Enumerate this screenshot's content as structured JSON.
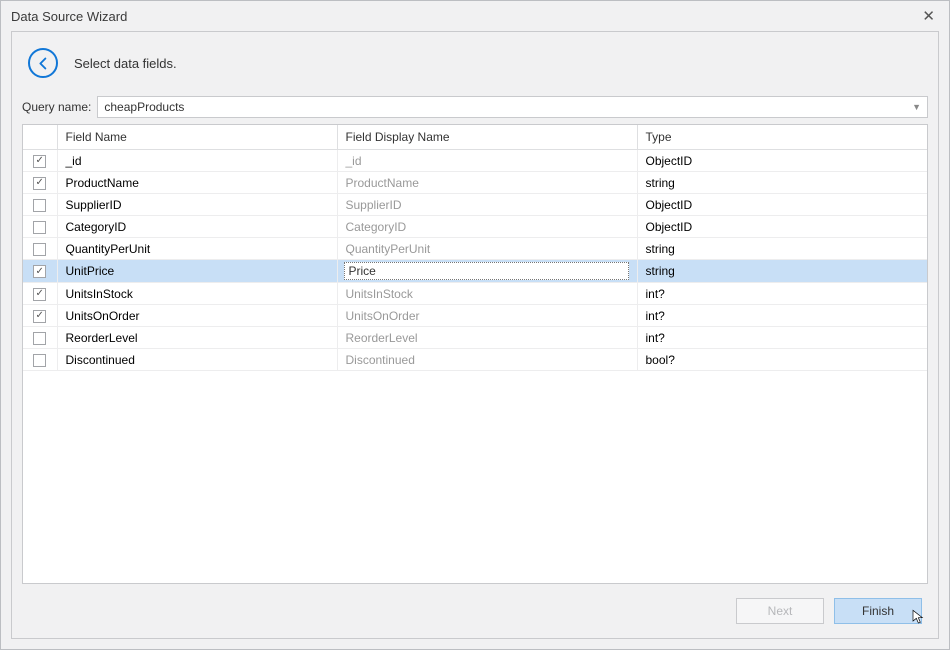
{
  "dialog": {
    "title": "Data Source Wizard",
    "close_glyph": "✕"
  },
  "header": {
    "instruction": "Select data fields."
  },
  "query": {
    "label": "Query name:",
    "value": "cheapProducts"
  },
  "grid": {
    "columns": {
      "check": "",
      "field_name": "Field Name",
      "display_name": "Field Display Name",
      "type": "Type"
    },
    "rows": [
      {
        "checked": true,
        "name": "_id",
        "display": "_id",
        "display_is_placeholder": true,
        "type": "ObjectID",
        "selected": false
      },
      {
        "checked": true,
        "name": "ProductName",
        "display": "ProductName",
        "display_is_placeholder": true,
        "type": "string",
        "selected": false
      },
      {
        "checked": false,
        "name": "SupplierID",
        "display": "SupplierID",
        "display_is_placeholder": true,
        "type": "ObjectID",
        "selected": false
      },
      {
        "checked": false,
        "name": "CategoryID",
        "display": "CategoryID",
        "display_is_placeholder": true,
        "type": "ObjectID",
        "selected": false
      },
      {
        "checked": false,
        "name": "QuantityPerUnit",
        "display": "QuantityPerUnit",
        "display_is_placeholder": true,
        "type": "string",
        "selected": false
      },
      {
        "checked": true,
        "name": "UnitPrice",
        "display": "Price",
        "display_is_placeholder": false,
        "type": "string",
        "selected": true
      },
      {
        "checked": true,
        "name": "UnitsInStock",
        "display": "UnitsInStock",
        "display_is_placeholder": true,
        "type": "int?",
        "selected": false
      },
      {
        "checked": true,
        "name": "UnitsOnOrder",
        "display": "UnitsOnOrder",
        "display_is_placeholder": true,
        "type": "int?",
        "selected": false
      },
      {
        "checked": false,
        "name": "ReorderLevel",
        "display": "ReorderLevel",
        "display_is_placeholder": true,
        "type": "int?",
        "selected": false
      },
      {
        "checked": false,
        "name": "Discontinued",
        "display": "Discontinued",
        "display_is_placeholder": true,
        "type": "bool?",
        "selected": false
      }
    ]
  },
  "buttons": {
    "next": "Next",
    "finish": "Finish"
  }
}
